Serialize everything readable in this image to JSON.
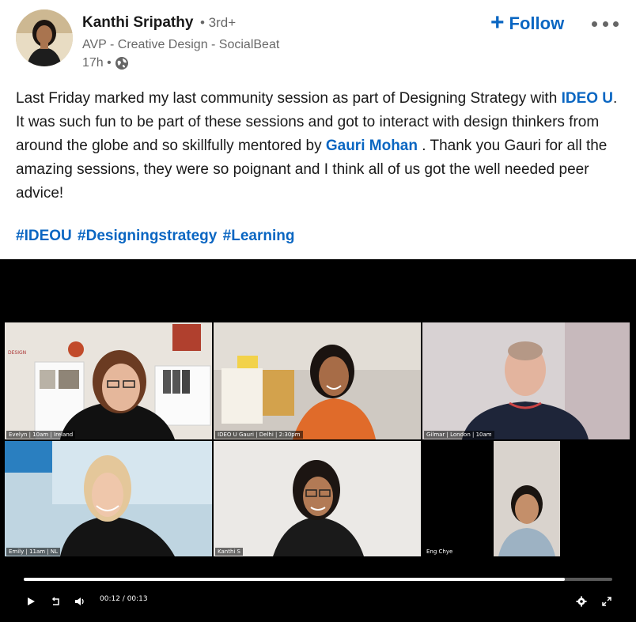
{
  "post": {
    "author": {
      "name": "Kanthi Sripathy",
      "degree": "• 3rd+",
      "headline": "AVP - Creative Design - SocialBeat",
      "time": "17h •",
      "visibility_icon": "globe-icon"
    },
    "follow_label": "Follow",
    "more_icon": "more-horizontal-icon",
    "text": {
      "p1": "Last Friday marked my last community session as part of Designing Strategy with ",
      "mention1": "IDEO U",
      "p2": ". It was such fun to be part of these sessions and got to interact with design thinkers from around the globe and so skillfully mentored by ",
      "mention2": "Gauri Mohan",
      "p3": " . Thank you Gauri for all the amazing sessions, they were so poignant and I think all of us got the well needed peer advice!"
    },
    "hashtags": [
      "#IDEOU",
      "#Designingstrategy",
      "#Learning"
    ]
  },
  "video": {
    "participants": [
      {
        "label": "Evelyn | 10am | Ireland"
      },
      {
        "label": "IDEO U Gauri | Delhi | 2:30pm"
      },
      {
        "label": "Gilmar | London | 10am"
      },
      {
        "label": "Emily | 11am | NL"
      },
      {
        "label": "Kanthi S"
      },
      {
        "label": "Eng Chye"
      }
    ],
    "progress_fraction": 0.92,
    "time": "00:12 / 00:13",
    "icons": [
      "play-icon",
      "replay-10-icon",
      "volume-icon",
      "settings-icon",
      "fullscreen-icon"
    ]
  },
  "colors": {
    "link": "#0a66c2",
    "video_bg": "#000000"
  }
}
